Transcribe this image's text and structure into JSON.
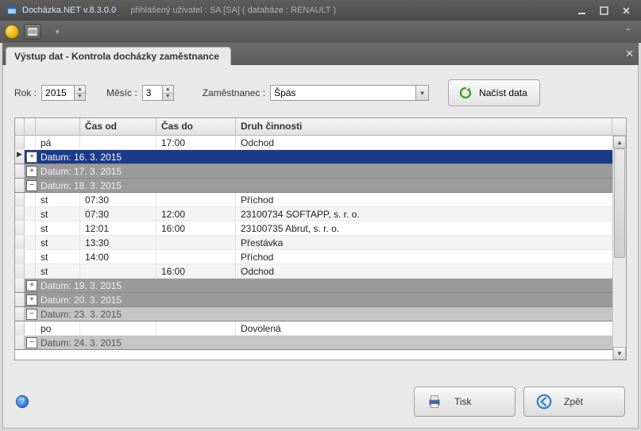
{
  "titlebar": {
    "app": "Docházka.NET v.8.3.0.0",
    "user": "přihlášený uživatel : SA [SA] ( databáze : RENAULT )"
  },
  "tab": {
    "title": "Výstup dat - Kontrola docházky zaměstnance"
  },
  "filters": {
    "year_label": "Rok :",
    "year_value": "2015",
    "month_label": "Měsíc :",
    "month_value": "3",
    "employee_label": "Zaměstnanec :",
    "employee_value": "Špás",
    "load_label": "Načíst data"
  },
  "grid": {
    "headers": {
      "from": "Čas od",
      "to": "Čas do",
      "type": "Druh činnosti"
    },
    "row_pa": {
      "day": "pá",
      "from": "",
      "to": "17:00",
      "type": "Odchod"
    },
    "g16": "Datum: 16. 3. 2015",
    "g17": "Datum: 17. 3. 2015",
    "g18": "Datum: 18. 3. 2015",
    "r18_1": {
      "day": "st",
      "from": "07:30",
      "to": "",
      "type": "Příchod"
    },
    "r18_2": {
      "day": "st",
      "from": "07:30",
      "to": "12:00",
      "type": "23100734 SOFTAPP, s. r. o."
    },
    "r18_3": {
      "day": "st",
      "from": "12:01",
      "to": "16:00",
      "type": "23100735 Abrut, s. r. o."
    },
    "r18_4": {
      "day": "st",
      "from": "13:30",
      "to": "",
      "type": "Přestávka"
    },
    "r18_5": {
      "day": "st",
      "from": "14:00",
      "to": "",
      "type": "Příchod"
    },
    "r18_6": {
      "day": "st",
      "from": "",
      "to": "16:00",
      "type": "Odchod"
    },
    "g19": "Datum: 19. 3. 2015",
    "g20": "Datum: 20. 3. 2015",
    "g23": "Datum: 23. 3. 2015",
    "r23_1": {
      "day": "po",
      "from": "",
      "to": "",
      "type": "Dovolená"
    },
    "g24": "Datum: 24. 3. 2015"
  },
  "buttons": {
    "print": "Tisk",
    "back": "Zpět"
  }
}
